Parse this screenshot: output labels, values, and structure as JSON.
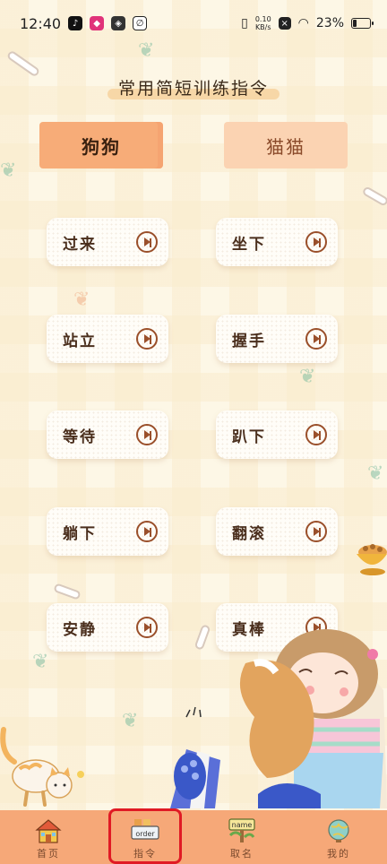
{
  "status_bar": {
    "time": "12:40",
    "net_speed_value": "0.10",
    "net_speed_unit": "KB/s",
    "battery": "23%"
  },
  "heading": "常用简短训练指令",
  "tabs": [
    {
      "label": "狗狗",
      "active": true
    },
    {
      "label": "猫猫",
      "active": false
    }
  ],
  "commands": [
    {
      "label": "过来"
    },
    {
      "label": "坐下"
    },
    {
      "label": "站立"
    },
    {
      "label": "握手"
    },
    {
      "label": "等待"
    },
    {
      "label": "趴下"
    },
    {
      "label": "躺下"
    },
    {
      "label": "翻滚"
    },
    {
      "label": "安静"
    },
    {
      "label": "真棒"
    }
  ],
  "bottom_nav": [
    {
      "label": "首页",
      "icon": "house-icon"
    },
    {
      "label": "指令",
      "icon": "order-icon",
      "icon_text": "order",
      "active": true
    },
    {
      "label": "取名",
      "icon": "name-sign-icon",
      "icon_text": "name"
    },
    {
      "label": "我的",
      "icon": "globe-icon"
    }
  ],
  "colors": {
    "accent": "#f6a878",
    "tab_active": "#f7ac78",
    "tab_inactive": "#fbd3b2",
    "play_icon": "#9a4f2a",
    "highlight": "#e01a24"
  }
}
